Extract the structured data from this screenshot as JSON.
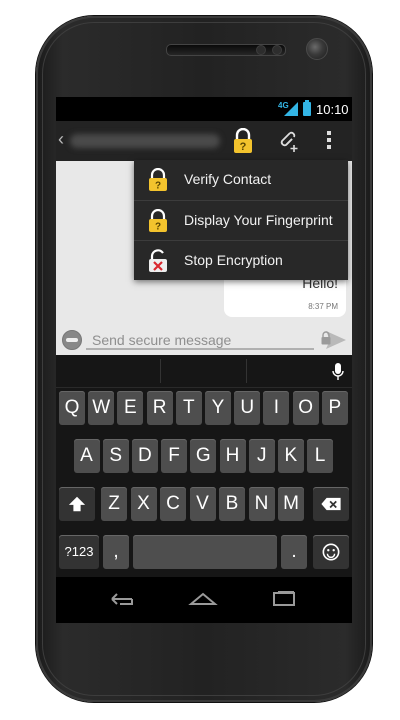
{
  "status": {
    "network": "4G",
    "time": "10:10"
  },
  "action_bar": {
    "icons": [
      "back-chevron",
      "lock-question-icon",
      "attach-add-icon",
      "overflow-menu-icon"
    ]
  },
  "menu": {
    "items": [
      {
        "label": "Verify Contact",
        "icon": "lock-question-icon"
      },
      {
        "label": "Display Your Fingerprint",
        "icon": "lock-question-icon"
      },
      {
        "label": "Stop Encryption",
        "icon": "unlock-x-icon"
      }
    ]
  },
  "conversation": {
    "message": "Hello!",
    "time": "8:37 PM"
  },
  "composer": {
    "placeholder": "Send secure message"
  },
  "keyboard": {
    "row1": [
      "Q",
      "W",
      "E",
      "R",
      "T",
      "Y",
      "U",
      "I",
      "O",
      "P"
    ],
    "row2": [
      "A",
      "S",
      "D",
      "F",
      "G",
      "H",
      "J",
      "K",
      "L"
    ],
    "row3": [
      "Z",
      "X",
      "C",
      "V",
      "B",
      "N",
      "M"
    ],
    "symbols_key": "?123",
    "comma_key": ",",
    "period_key": "."
  },
  "colors": {
    "accent": "#33b5e5",
    "lock_yellow": "#f3c32d"
  }
}
